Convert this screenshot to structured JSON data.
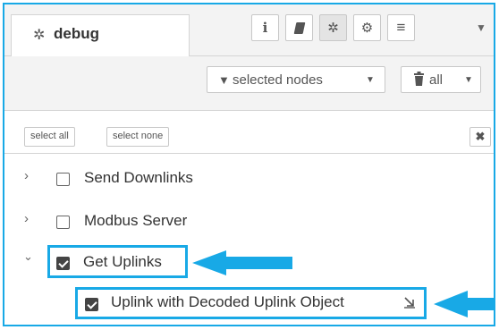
{
  "tab": {
    "icon": "bug-icon",
    "label": "debug"
  },
  "tab_buttons": [
    {
      "name": "info-button",
      "icon": "info-icon",
      "glyph": "i"
    },
    {
      "name": "help-button",
      "icon": "book-icon",
      "glyph": "▰"
    },
    {
      "name": "debug-button",
      "icon": "bug-icon",
      "glyph": "✲"
    },
    {
      "name": "config-button",
      "icon": "gear-icon",
      "glyph": "⚙"
    },
    {
      "name": "context-button",
      "icon": "database-icon",
      "glyph": "≡"
    }
  ],
  "toolbar": {
    "filter_label": "selected nodes",
    "filter_icon": "filter-icon",
    "clear_label": "all",
    "clear_icon": "trash-icon"
  },
  "filter_panel": {
    "select_all": "select all",
    "select_none": "select none",
    "close_icon": "close-icon",
    "close_glyph": "✖",
    "rows": [
      {
        "label": "Send Downlinks",
        "expanded": false,
        "checked": false
      },
      {
        "label": "Modbus Server",
        "expanded": false,
        "checked": false
      },
      {
        "label": "Get Uplinks",
        "expanded": true,
        "checked": true
      },
      {
        "label": "Uplink with Decoded Uplink Object",
        "checked": true,
        "child": true,
        "icon": "resize-arrow-icon"
      }
    ]
  },
  "colors": {
    "highlight": "#18a9e6",
    "arrow": "#18a9e6"
  }
}
